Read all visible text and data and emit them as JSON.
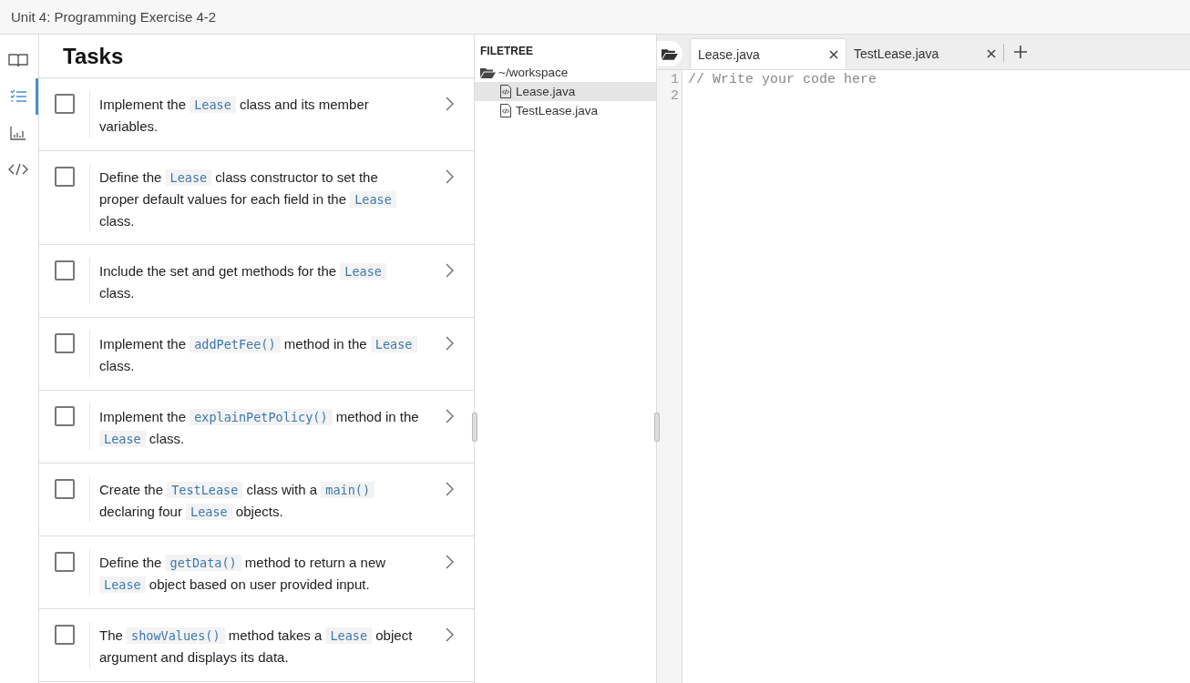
{
  "window": {
    "title": "Unit 4: Programming Exercise 4-2"
  },
  "sidebar": {
    "items": [
      {
        "selected": false
      },
      {
        "selected": true
      },
      {
        "selected": false
      },
      {
        "selected": false
      }
    ]
  },
  "tasks": {
    "title": "Tasks",
    "items": [
      {
        "checked": false,
        "segments": [
          {
            "kind": "text",
            "text": "Implement the "
          },
          {
            "kind": "code",
            "text": "Lease"
          },
          {
            "kind": "text",
            "text": " class and its member variables."
          }
        ]
      },
      {
        "checked": false,
        "segments": [
          {
            "kind": "text",
            "text": "Define the "
          },
          {
            "kind": "code",
            "text": "Lease"
          },
          {
            "kind": "text",
            "text": " class constructor to set the proper default values for each field in the "
          },
          {
            "kind": "code",
            "text": "Lease"
          },
          {
            "kind": "text",
            "text": " class."
          }
        ]
      },
      {
        "checked": false,
        "segments": [
          {
            "kind": "text",
            "text": "Include the set and get methods for the "
          },
          {
            "kind": "code",
            "text": "Lease"
          },
          {
            "kind": "text",
            "text": " class."
          }
        ]
      },
      {
        "checked": false,
        "segments": [
          {
            "kind": "text",
            "text": "Implement the "
          },
          {
            "kind": "code",
            "text": "addPetFee()"
          },
          {
            "kind": "text",
            "text": " method in the "
          },
          {
            "kind": "code",
            "text": "Lease"
          },
          {
            "kind": "text",
            "text": " class."
          }
        ]
      },
      {
        "checked": false,
        "segments": [
          {
            "kind": "text",
            "text": "Implement the "
          },
          {
            "kind": "code",
            "text": "explainPetPolicy()"
          },
          {
            "kind": "text",
            "text": " method in the "
          },
          {
            "kind": "code",
            "text": "Lease"
          },
          {
            "kind": "text",
            "text": " class."
          }
        ]
      },
      {
        "checked": false,
        "segments": [
          {
            "kind": "text",
            "text": "Create the "
          },
          {
            "kind": "code",
            "text": "TestLease"
          },
          {
            "kind": "text",
            "text": " class with a "
          },
          {
            "kind": "code",
            "text": "main()"
          },
          {
            "kind": "text",
            "text": " declaring four "
          },
          {
            "kind": "code",
            "text": "Lease"
          },
          {
            "kind": "text",
            "text": " objects."
          }
        ]
      },
      {
        "checked": false,
        "segments": [
          {
            "kind": "text",
            "text": "Define the "
          },
          {
            "kind": "code",
            "text": "getData()"
          },
          {
            "kind": "text",
            "text": " method to return a new "
          },
          {
            "kind": "code",
            "text": "Lease"
          },
          {
            "kind": "text",
            "text": " object based on user provided input."
          }
        ]
      },
      {
        "checked": false,
        "segments": [
          {
            "kind": "text",
            "text": "The "
          },
          {
            "kind": "code",
            "text": "showValues()"
          },
          {
            "kind": "text",
            "text": " method takes a "
          },
          {
            "kind": "code",
            "text": "Lease"
          },
          {
            "kind": "text",
            "text": " object argument and displays its data."
          }
        ]
      }
    ]
  },
  "filetree": {
    "title": "FILETREE",
    "folder": "~/workspace",
    "files": [
      {
        "name": "Lease.java",
        "selected": true
      },
      {
        "name": "TestLease.java",
        "selected": false
      }
    ]
  },
  "editor": {
    "tabs": [
      {
        "label": "Lease.java",
        "selected": true
      },
      {
        "label": "TestLease.java",
        "selected": false
      }
    ],
    "lines": [
      {
        "number": "1",
        "code": "// Write your code here"
      },
      {
        "number": "2"
      }
    ]
  }
}
